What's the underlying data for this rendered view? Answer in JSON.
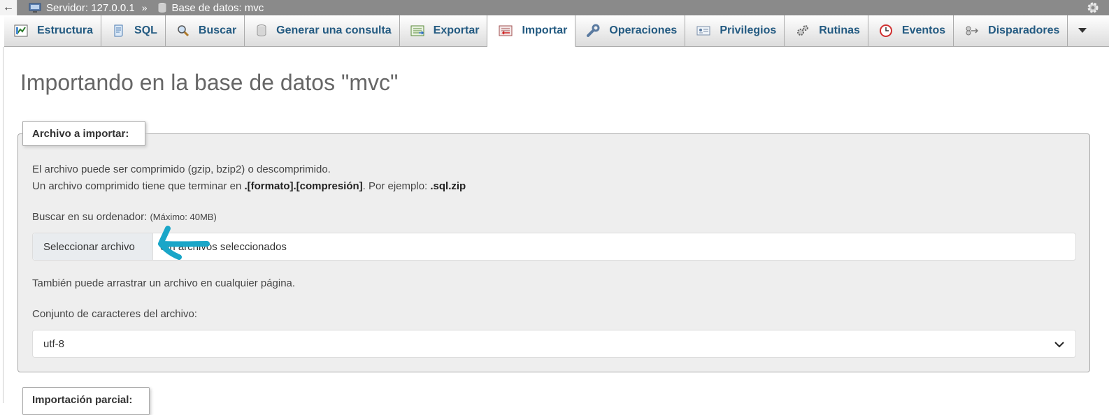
{
  "breadcrumb": {
    "back": "←",
    "server": "Servidor: 127.0.0.1",
    "separator": "»",
    "database": "Base de datos: mvc"
  },
  "tabs": [
    {
      "label": "Estructura",
      "icon": "structure-icon"
    },
    {
      "label": "SQL",
      "icon": "sql-icon"
    },
    {
      "label": "Buscar",
      "icon": "search-icon"
    },
    {
      "label": "Generar una consulta",
      "icon": "query-icon"
    },
    {
      "label": "Exportar",
      "icon": "export-icon"
    },
    {
      "label": "Importar",
      "icon": "import-icon",
      "active": true
    },
    {
      "label": "Operaciones",
      "icon": "wrench-icon"
    },
    {
      "label": "Privilegios",
      "icon": "privileges-icon"
    },
    {
      "label": "Rutinas",
      "icon": "routines-icon"
    },
    {
      "label": "Eventos",
      "icon": "clock-icon"
    },
    {
      "label": "Disparadores",
      "icon": "triggers-icon"
    }
  ],
  "page": {
    "title": "Importando en la base de datos \"mvc\""
  },
  "file_section": {
    "legend": "Archivo a importar:",
    "line1": "El archivo puede ser comprimido (gzip, bzip2) o descomprimido.",
    "line2_a": "Un archivo comprimido tiene que terminar en ",
    "line2_b": ".[formato].[compresión]",
    "line2_c": ". Por ejemplo: ",
    "line2_d": ".sql.zip",
    "browse_label": "Buscar en su ordenador: ",
    "max_size": "(Máximo: 40MB)",
    "choose_button": "Seleccionar archivo",
    "no_file": "Sin archivos seleccionados",
    "drag_hint": "También puede arrastrar un archivo en cualquier página.",
    "charset_label": "Conjunto de caracteres del archivo:",
    "charset_value": "utf-8"
  },
  "partial_section": {
    "legend": "Importación parcial:"
  },
  "annotation": {
    "arrow_color": "#1aa6c8"
  },
  "colors": {
    "tab_text": "#235a81",
    "topbar_bg": "#8a8a8a"
  }
}
